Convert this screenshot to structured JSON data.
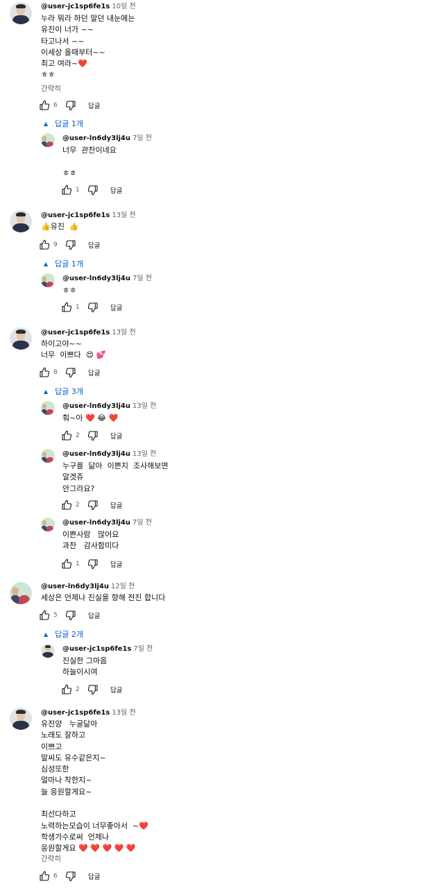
{
  "labels": {
    "reply": "답글",
    "read_more": "간략히"
  },
  "threads": [
    {
      "author": "@user-jc1sp6fe1s",
      "time": "10일 전",
      "text": "누라 뭐라 하던 말던 내눈에는\n유진이 너가 ~~\n타고나서 ~~\n이세상 올때부터~~\n최고 여라~❤️\nㅎㅎ",
      "likes": "6",
      "toggle": "답글 1개",
      "replies": [
        {
          "author": "@user-ln6dy3lj4u",
          "time": "7일 전",
          "text": "너무  관찬이네요\n\nㅎㅎ",
          "likes": "1"
        }
      ]
    },
    {
      "author": "@user-jc1sp6fe1s",
      "time": "13일 전",
      "text": "👍유진  👍",
      "likes": "9",
      "toggle": "답글 1개",
      "replies": [
        {
          "author": "@user-ln6dy3lj4u",
          "time": "7일 전",
          "text": "ㅎㅎ",
          "likes": "1"
        }
      ]
    },
    {
      "author": "@user-jc1sp6fe1s",
      "time": "13일 전",
      "text": "하이고야~~\n너무  이쁘다  😍 💕",
      "likes": "8",
      "toggle": "답글 3개",
      "replies": [
        {
          "author": "@user-ln6dy3lj4u",
          "time": "13일 전",
          "text": "훠~아 ❤️ 😂 ❤️",
          "likes": "2"
        },
        {
          "author": "@user-ln6dy3lj4u",
          "time": "13일 전",
          "text": "누구를  닮아  이쁜지  조사해보면\n알겟쥬\n안그라요?",
          "likes": "2"
        },
        {
          "author": "@user-ln6dy3lj4u",
          "time": "7일 전",
          "text": "이쁜사람   많어요\n과찬   감사함미다",
          "likes": "1"
        }
      ]
    },
    {
      "author": "@user-ln6dy3lj4u",
      "time": "12일 전",
      "text": "세상은 언제나 진실을 향해 전진 합니다",
      "likes": "5",
      "toggle": "답글 2개",
      "replies": [
        {
          "author": "@user-jc1sp6fe1s",
          "time": "7일 전",
          "text": "진실한 그마음\n하늘이시여",
          "likes": "2"
        }
      ]
    },
    {
      "author": "@user-jc1sp6fe1s",
      "time": "13일 전",
      "text": "유진양   누굴닮아\n노래도 잘하고\n이쁘고\n말씨도 유수같은지~\n심성또한\n얼마나 착한지~\n늘 응원할게요~\n\n최선다하고\n노력하는모습이 너무좋아서  ~❤️\n학생가수로써  언제나\n응원할게요 ❤️ ❤️ ❤️ ❤️ ❤️",
      "likes": "6"
    }
  ]
}
